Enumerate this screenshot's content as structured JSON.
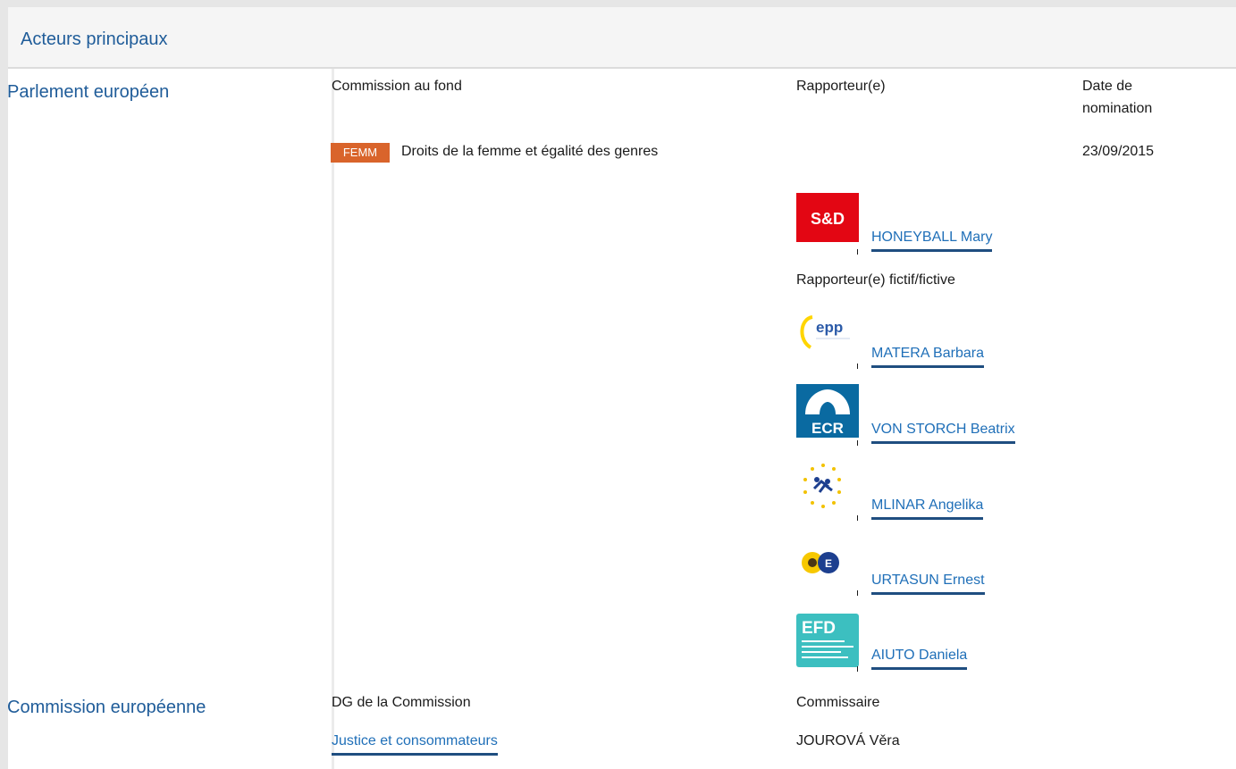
{
  "header": {
    "title": "Acteurs principaux"
  },
  "parliament": {
    "title": "Parlement européen",
    "col_committee": "Commission au fond",
    "col_rapporteur": "Rapporteur(e)",
    "col_date_line1": "Date de",
    "col_date_line2": "nomination",
    "committee_badge": "FEMM",
    "committee_name": "Droits de la femme et égalité des genres",
    "date": "23/09/2015",
    "rapporteur": {
      "group_logo": "S&D",
      "name": "HONEYBALL Mary"
    },
    "shadow_label": "Rapporteur(e) fictif/fictive",
    "shadows": [
      {
        "group_logo": "epp",
        "name": "MATERA Barbara"
      },
      {
        "group_logo": "ECR",
        "name": "VON STORCH Beatrix"
      },
      {
        "group_logo": "ALDE",
        "name": "MLINAR Angelika"
      },
      {
        "group_logo": "Verts/ALE",
        "name": "URTASUN Ernest"
      },
      {
        "group_logo": "EFD",
        "name": "AIUTO Daniela"
      }
    ]
  },
  "commission": {
    "title": "Commission européenne",
    "col_dg": "DG de la Commission",
    "col_commissioner": "Commissaire",
    "dg_name": "Justice et consommateurs",
    "commissioner_name": "JOUROVÁ Věra"
  },
  "colors": {
    "accent": "#1f5c99",
    "link": "#1f6fb8",
    "badge": "#d9642b",
    "sd_red": "#e30613",
    "ecr_blue": "#0a6aa1",
    "efd_teal": "#3cbfc0"
  }
}
